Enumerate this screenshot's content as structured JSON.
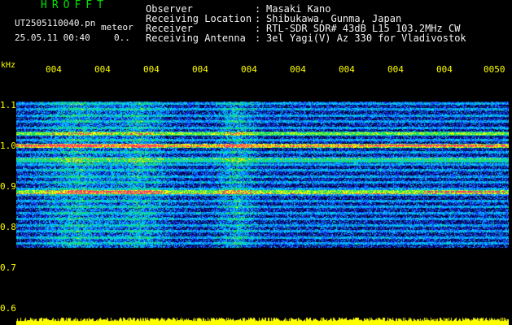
{
  "header": {
    "title": "HROFFT",
    "filename": "UT2505110040.pn",
    "meteor_label": "meteor",
    "datetime": "25.05.11 00:40",
    "counter": "0..",
    "fields": [
      {
        "label": "Observer",
        "sep": ":",
        "value": "Masaki Kano"
      },
      {
        "label": "Receiving Location",
        "sep": ":",
        "value": "Shibukawa, Gunma, Japan"
      },
      {
        "label": "Receiver",
        "sep": ":",
        "value": "RTL-SDR SDR# 43dB L15 103.2MHz CW"
      },
      {
        "label": "Receiving Antenna",
        "sep": ":",
        "value": "3el Yagi(V) Az 330 for Vladivostok"
      }
    ]
  },
  "axis": {
    "unit": "kHz",
    "y_ticks": [
      "1.1",
      "1.0",
      "0.9",
      "0.8",
      "0.7",
      "0.6"
    ],
    "x_ticks": [
      "004",
      "004",
      "004",
      "004",
      "004",
      "004",
      "004",
      "004",
      "004",
      "0050"
    ]
  },
  "spectrogram": {
    "freq_range_khz": [
      0.6,
      1.1
    ],
    "signal_band_khz": [
      0.75,
      1.05
    ],
    "strong_lines_khz": [
      0.96,
      0.865,
      0.985,
      0.93
    ],
    "colors": {
      "background": "#00003c",
      "low": "#1a3cff",
      "mid": "#00c8ff",
      "high": "#ffff00",
      "peak": "#ff3a6a",
      "baseline": "#ffff00"
    }
  }
}
